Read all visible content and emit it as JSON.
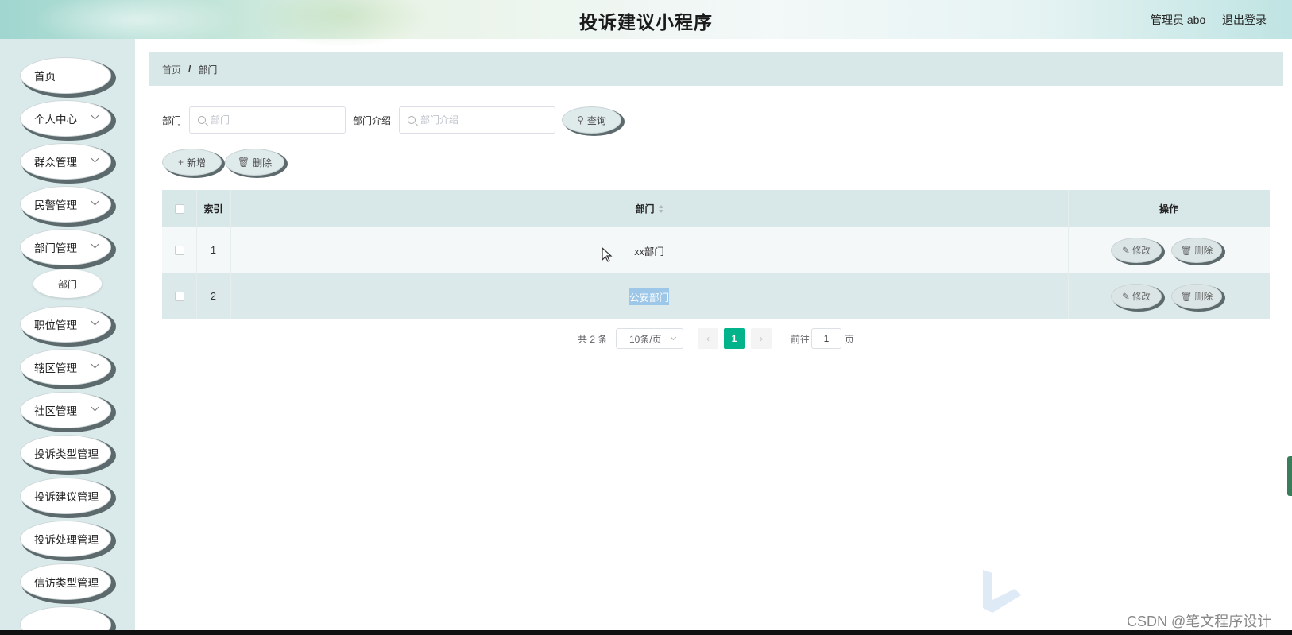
{
  "header": {
    "title": "投诉建议小程序",
    "user": "管理员 abo",
    "logout": "退出登录"
  },
  "sidebar": {
    "items": [
      {
        "label": "首页",
        "expandable": false
      },
      {
        "label": "个人中心",
        "expandable": true
      },
      {
        "label": "群众管理",
        "expandable": true
      },
      {
        "label": "民警管理",
        "expandable": true
      },
      {
        "label": "部门管理",
        "expandable": true
      },
      {
        "label": "职位管理",
        "expandable": true
      },
      {
        "label": "辖区管理",
        "expandable": true
      },
      {
        "label": "社区管理",
        "expandable": true
      },
      {
        "label": "投诉类型管理",
        "expandable": false
      },
      {
        "label": "投诉建议管理",
        "expandable": false
      },
      {
        "label": "投诉处理管理",
        "expandable": false
      },
      {
        "label": "信访类型管理",
        "expandable": false
      }
    ],
    "submenu": {
      "label": "部门"
    }
  },
  "breadcrumb": {
    "home": "首页",
    "separator": "/",
    "current": "部门"
  },
  "search": {
    "dept_label": "部门",
    "dept_placeholder": "部门",
    "intro_label": "部门介绍",
    "intro_placeholder": "部门介绍",
    "query_label": "查询"
  },
  "actions": {
    "add_label": "新增",
    "delete_label": "删除"
  },
  "table": {
    "headers": {
      "index": "索引",
      "dept": "部门",
      "ops": "操作"
    },
    "rows": [
      {
        "index": "1",
        "dept": "xx部门",
        "edit": "修改",
        "delete": "删除"
      },
      {
        "index": "2",
        "dept": "公安部门",
        "edit": "修改",
        "delete": "删除"
      }
    ]
  },
  "pagination": {
    "total": "共 2 条",
    "page_size": "10条/页",
    "current_page": "1",
    "goto_label": "前往",
    "goto_value": "1",
    "page_suffix": "页"
  },
  "watermark": "CSDN @笔文程序设计",
  "colors": {
    "sidebar_bg": "#dae9ea",
    "header_bar": "#d8e7e8",
    "accent_green": "#00b38a"
  }
}
